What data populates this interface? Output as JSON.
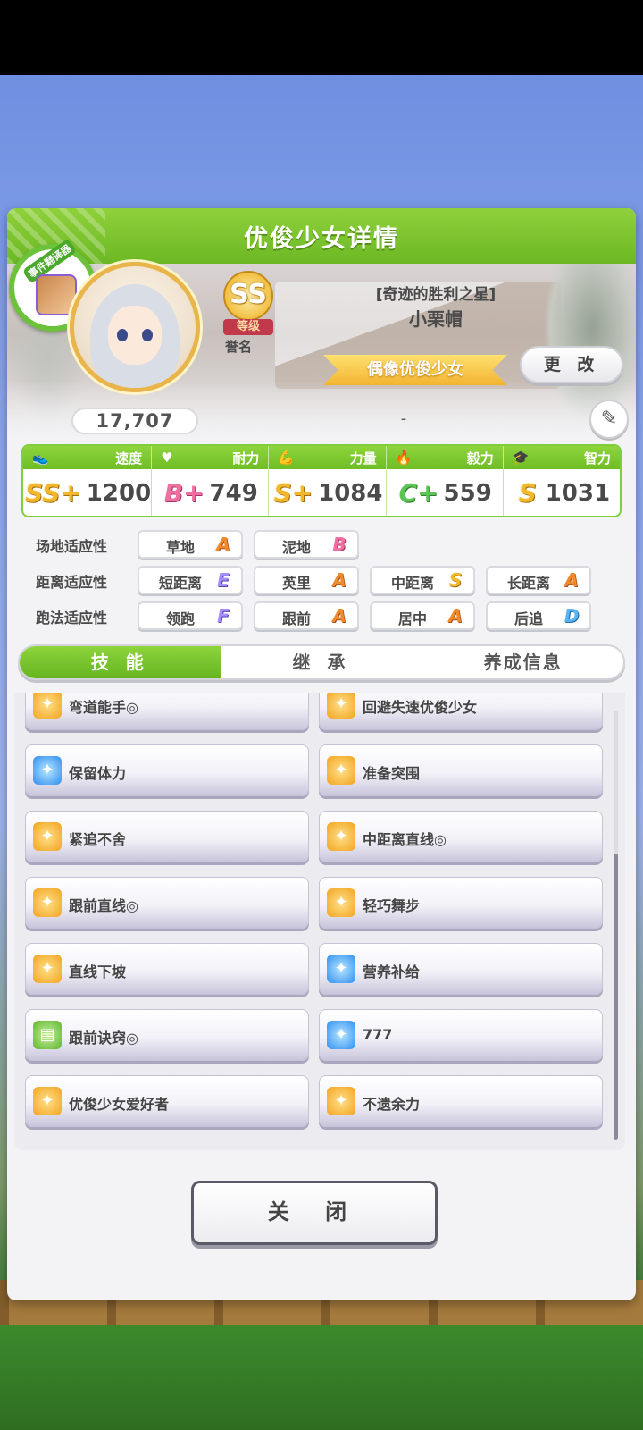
{
  "dialog": {
    "title": "优俊少女详情"
  },
  "badge": {
    "label": "事件翻译器"
  },
  "profile": {
    "fans": "17,707",
    "rank": "SS",
    "rank_label": "等级",
    "honor_label": "誉名",
    "epithet": "[奇迹的胜利之星]",
    "name": "小栗帽",
    "title": "偶像优俊少女",
    "change_button": "更 改",
    "sub_value": "-"
  },
  "stats": [
    {
      "label": "速度",
      "icon": "shoe-icon",
      "grade": "SS+",
      "value": "1200"
    },
    {
      "label": "耐力",
      "icon": "heart-icon",
      "grade": "B+",
      "value": "749"
    },
    {
      "label": "力量",
      "icon": "muscle-icon",
      "grade": "S+",
      "value": "1084"
    },
    {
      "label": "毅力",
      "icon": "flame-icon",
      "grade": "C+",
      "value": "559"
    },
    {
      "label": "智力",
      "icon": "graduation-cap-icon",
      "grade": "S",
      "value": "1031"
    }
  ],
  "aptitudes": {
    "track": {
      "label": "场地适应性",
      "items": [
        {
          "name": "草地",
          "grade": "A"
        },
        {
          "name": "泥地",
          "grade": "B"
        }
      ]
    },
    "distance": {
      "label": "距离适应性",
      "items": [
        {
          "name": "短距离",
          "grade": "E"
        },
        {
          "name": "英里",
          "grade": "A"
        },
        {
          "name": "中距离",
          "grade": "S"
        },
        {
          "name": "长距离",
          "grade": "A"
        }
      ]
    },
    "strategy": {
      "label": "跑法适应性",
      "items": [
        {
          "name": "领跑",
          "grade": "F"
        },
        {
          "name": "跟前",
          "grade": "A"
        },
        {
          "name": "居中",
          "grade": "A"
        },
        {
          "name": "后追",
          "grade": "D"
        }
      ]
    }
  },
  "tabs": [
    {
      "label": "技 能"
    },
    {
      "label": "继 承"
    },
    {
      "label": "养成信息"
    }
  ],
  "skills": [
    {
      "name": "弯道能手◎",
      "icon": "gold"
    },
    {
      "name": "回避失速优俊少女",
      "icon": "gold"
    },
    {
      "name": "保留体力",
      "icon": "blue"
    },
    {
      "name": "准备突围",
      "icon": "gold"
    },
    {
      "name": "紧追不舍",
      "icon": "gold"
    },
    {
      "name": "中距离直线◎",
      "icon": "gold"
    },
    {
      "name": "跟前直线◎",
      "icon": "gold"
    },
    {
      "name": "轻巧舞步",
      "icon": "gold"
    },
    {
      "name": "直线下坡",
      "icon": "gold"
    },
    {
      "name": "营养补给",
      "icon": "blue"
    },
    {
      "name": "跟前诀窍◎",
      "icon": "green"
    },
    {
      "name": "777",
      "icon": "blue"
    },
    {
      "name": "优俊少女爱好者",
      "icon": "gold"
    },
    {
      "name": "不遗余力",
      "icon": "gold"
    }
  ],
  "close_button": "关 闭"
}
